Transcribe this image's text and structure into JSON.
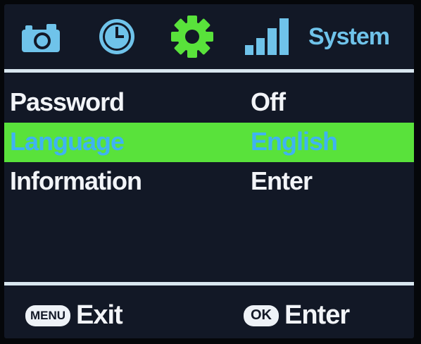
{
  "colors": {
    "background": "#121826",
    "text": "#f2f4f8",
    "accent_blue": "#6fc3ea",
    "highlight_green": "#59e23b",
    "highlight_text": "#3fb3f2",
    "divider": "#d8e6ef"
  },
  "tabs": [
    {
      "icon": "camera-icon",
      "active": false
    },
    {
      "icon": "clock-icon",
      "active": false
    },
    {
      "icon": "gear-icon",
      "active": true
    },
    {
      "icon": "signal-icon",
      "active": false
    },
    {
      "label": "System",
      "active": false
    }
  ],
  "tab_system_label": "System",
  "menu": {
    "items": [
      {
        "label": "Password",
        "value": "Off",
        "selected": false
      },
      {
        "label": "Language",
        "value": "English",
        "selected": true
      },
      {
        "label": "Information",
        "value": "Enter",
        "selected": false
      }
    ]
  },
  "footer": {
    "menu_key": "MENU",
    "menu_action": "Exit",
    "ok_key": "OK",
    "ok_action": "Enter"
  }
}
